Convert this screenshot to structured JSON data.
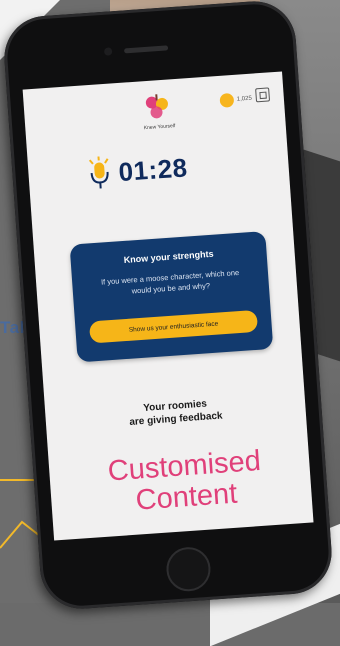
{
  "background": {
    "side_word": "Talk"
  },
  "app": {
    "logo_caption": "Knew Yourself",
    "coins_label": "1,025",
    "timer": "01:28",
    "card": {
      "title": "Know your strenghts",
      "body": "If you were a moose character, which one would you be and why?",
      "button_label": "Show us your enthusiastic face"
    },
    "feedback_line1": "Your roomies",
    "feedback_line2": "are giving feedback"
  },
  "overlay": {
    "line1": "Customised",
    "line2": "Content"
  },
  "colors": {
    "navy": "#123a6e",
    "accent_yellow": "#f6b518",
    "overlay_pink": "#e0407a"
  }
}
